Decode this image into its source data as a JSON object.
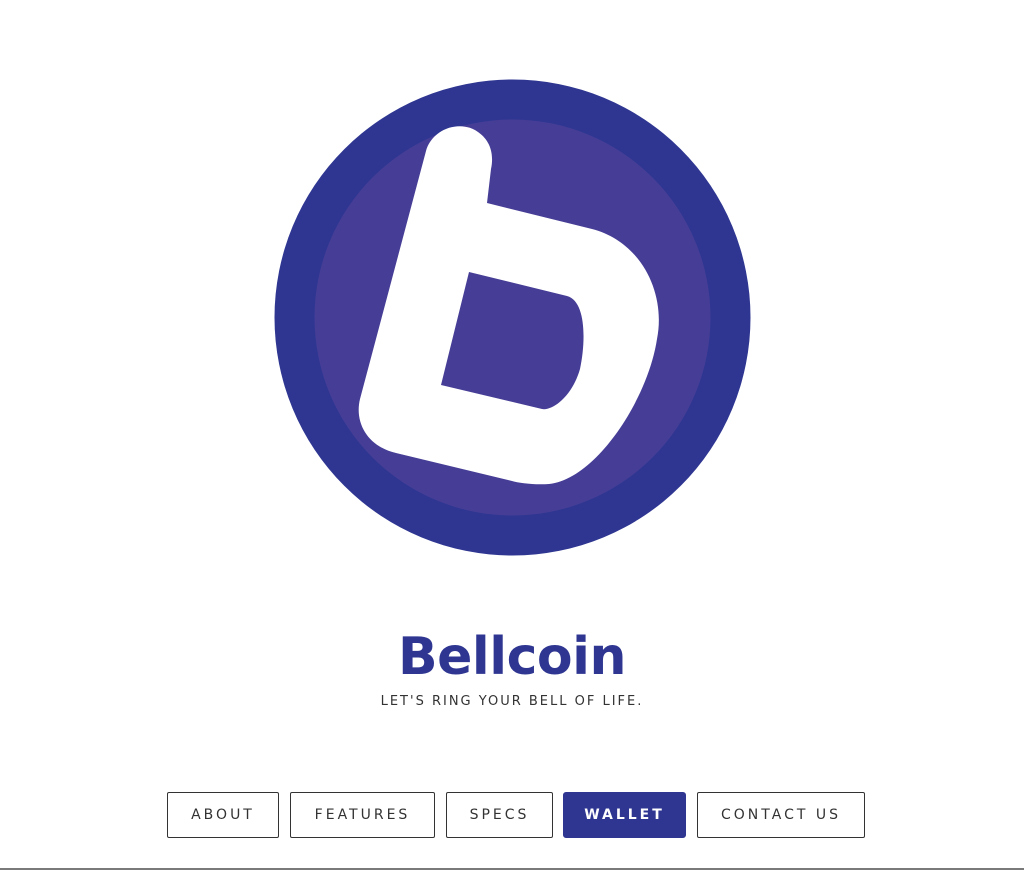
{
  "brand": {
    "title": "Bellcoin",
    "tagline": "LET'S RING YOUR BELL OF LIFE.",
    "logo_icon": "bellcoin-b-logo-icon"
  },
  "nav": {
    "items": [
      {
        "label": "ABOUT",
        "active": false
      },
      {
        "label": "FEATURES",
        "active": false
      },
      {
        "label": "SPECS",
        "active": false
      },
      {
        "label": "WALLET",
        "active": true
      },
      {
        "label": "CONTACT US",
        "active": false
      }
    ]
  },
  "colors": {
    "brand_primary": "#2e3691",
    "logo_inner": "#463e96",
    "logo_glyph": "#ffffff",
    "text_dark": "#333333",
    "background": "#ffffff"
  }
}
